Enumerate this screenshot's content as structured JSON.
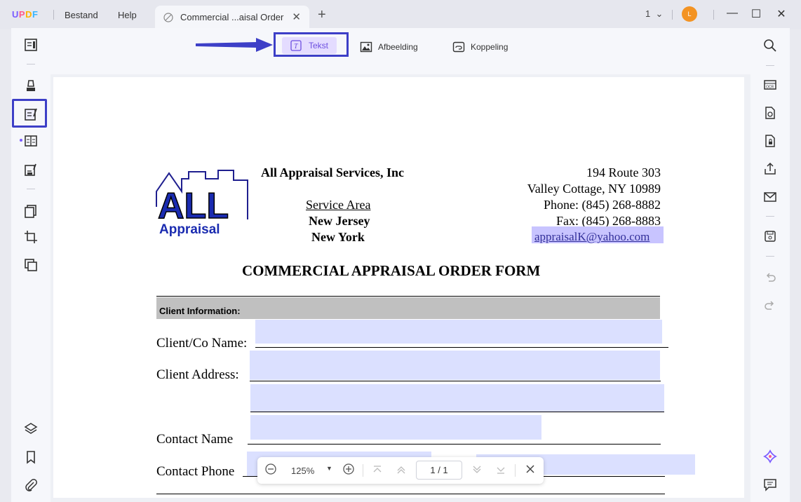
{
  "app": {
    "logo": "UPDF",
    "menu": [
      "Bestand",
      "Help"
    ],
    "tab_title": "Commercial ...aisal Order",
    "page_selector": "1",
    "avatar_initial": "L"
  },
  "toolbar": {
    "tekst_label": "Tekst",
    "afbeelding_label": "Afbeelding",
    "koppeling_label": "Koppeling"
  },
  "document": {
    "company": "All Appraisal Services, Inc",
    "logo_big": "ALL",
    "logo_small": "Appraisal",
    "service_area_label": "Service Area",
    "areas": [
      "New Jersey",
      "New York"
    ],
    "address": [
      "194 Route 303",
      "Valley Cottage, NY 10989",
      "Phone:  (845) 268-8882",
      "Fax:  (845) 268-8883"
    ],
    "email": "appraisalK@yahoo.com",
    "form_title": "COMMERCIAL APPRAISAL ORDER FORM",
    "section_header": "Client Information:",
    "fields": {
      "client_name": "Client/Co Name:",
      "client_address": "Client Address:",
      "contact_name": "Contact Name",
      "contact_phone": "Contact Phone"
    }
  },
  "zoom": {
    "level": "125%",
    "page_current": "1",
    "page_total": "1"
  },
  "colors": {
    "accent": "#7b5cff",
    "highlight_box": "#3d3fc7",
    "field_fill": "#dbe0ff"
  }
}
